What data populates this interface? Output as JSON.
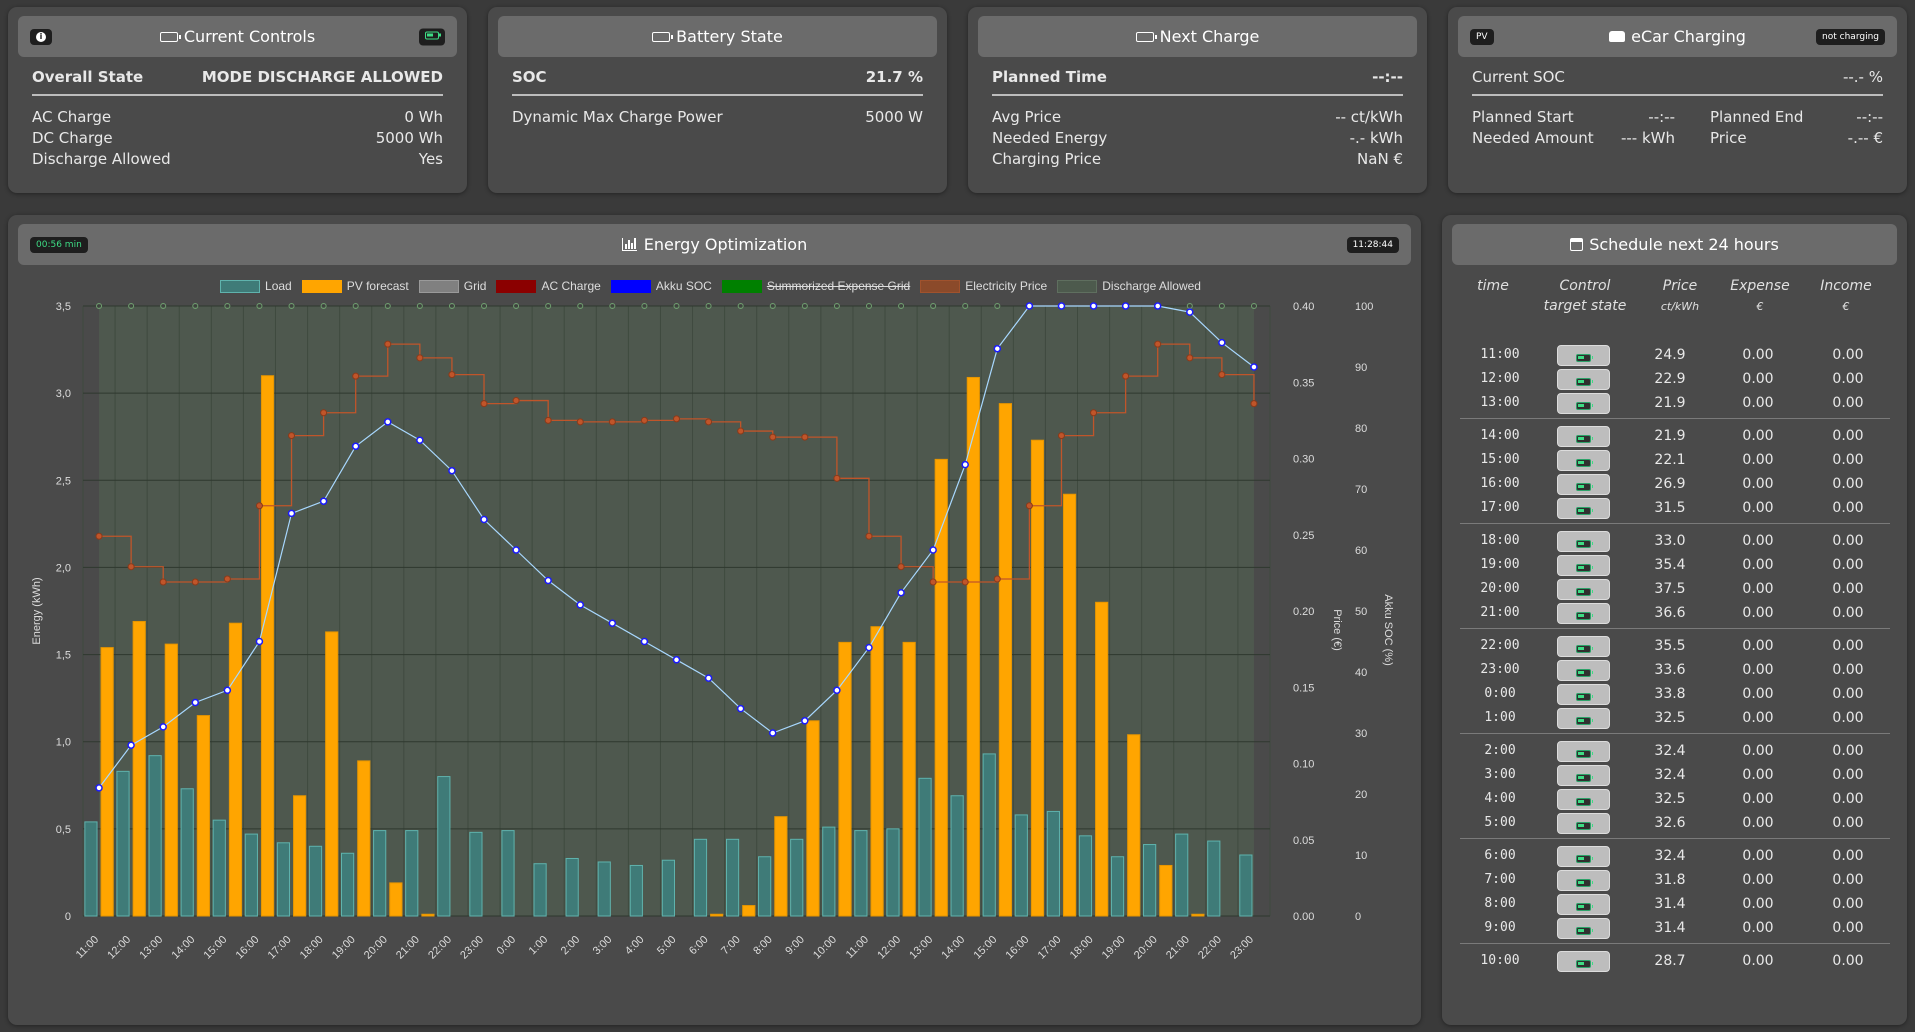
{
  "controls": {
    "title": "Current Controls",
    "overall_label": "Overall State",
    "overall_value": "MODE DISCHARGE ALLOWED",
    "rows": [
      {
        "label": "AC Charge",
        "value": "0 Wh"
      },
      {
        "label": "DC Charge",
        "value": "5000 Wh"
      },
      {
        "label": "Discharge Allowed",
        "value": "Yes"
      }
    ]
  },
  "battery": {
    "title": "Battery State",
    "soc_label": "SOC",
    "soc_value": "21.7 %",
    "rows": [
      {
        "label": "Dynamic Max Charge Power",
        "value": "5000 W"
      }
    ]
  },
  "next_charge": {
    "title": "Next Charge",
    "planned_label": "Planned Time",
    "planned_value": "--:--",
    "rows": [
      {
        "label": "Avg Price",
        "value": "-- ct/kWh"
      },
      {
        "label": "Needed Energy",
        "value": "-.- kWh"
      },
      {
        "label": "Charging Price",
        "value": "NaN €"
      }
    ]
  },
  "ecar": {
    "title": "eCar Charging",
    "badge_left": "PV",
    "badge_right": "not charging",
    "soc_label": "Current SOC",
    "soc_value": "--.- %",
    "left_rows": [
      {
        "label": "Planned Start",
        "value": "--:--"
      },
      {
        "label": "Needed Amount",
        "value": "--- kWh"
      }
    ],
    "right_rows": [
      {
        "label": "Planned End",
        "value": "--:--"
      },
      {
        "label": "Price",
        "value": "-.-- €"
      }
    ]
  },
  "optimization": {
    "title": "Energy Optimization",
    "badge_left": "00:56 min",
    "badge_right": "11:28:44",
    "legend": [
      {
        "label": "Load",
        "fill": "#3f7b78",
        "border": "#5fb3ad"
      },
      {
        "label": "PV forecast",
        "fill": "#ffa500",
        "border": "#ffa500"
      },
      {
        "label": "Grid",
        "fill": "#808080",
        "border": "#9a9a9a"
      },
      {
        "label": "AC Charge",
        "fill": "#8b0000",
        "border": "#8b0000"
      },
      {
        "label": "Akku SOC",
        "fill": "#0000ff",
        "border": "#0000ff"
      },
      {
        "label": "Summorized Expense Grid",
        "fill": "#008000",
        "border": "#008000",
        "strike": true
      },
      {
        "label": "Electricity Price",
        "fill": "#8b4a2a",
        "border": "#a0522d"
      },
      {
        "label": "Discharge Allowed",
        "fill": "#4d5a4d",
        "border": "#5f6f5f"
      }
    ]
  },
  "chart_data": {
    "type": "bar",
    "title": "",
    "categories": [
      "11:00",
      "12:00",
      "13:00",
      "14:00",
      "15:00",
      "16:00",
      "17:00",
      "18:00",
      "19:00",
      "20:00",
      "21:00",
      "22:00",
      "23:00",
      "0:00",
      "1:00",
      "2:00",
      "3:00",
      "4:00",
      "5:00",
      "6:00",
      "7:00",
      "8:00",
      "9:00",
      "10:00",
      "11:00",
      "12:00",
      "13:00",
      "14:00",
      "15:00",
      "16:00",
      "17:00",
      "18:00",
      "19:00",
      "20:00",
      "21:00",
      "22:00",
      "23:00"
    ],
    "y_left": {
      "label": "Energy (kWh)",
      "ticks": [
        "0",
        "0,5",
        "1,0",
        "1,5",
        "2,0",
        "2,5",
        "3,0",
        "3,5"
      ],
      "range": [
        0,
        3.5
      ]
    },
    "y_price": {
      "label": "Price (€)",
      "ticks": [
        "0.00",
        "0.05",
        "0.10",
        "0.15",
        "0.20",
        "0.25",
        "0.30",
        "0.35",
        "0.40"
      ],
      "range": [
        0,
        0.4
      ]
    },
    "y_soc": {
      "label": "Akku SOC (%)",
      "ticks": [
        "0",
        "10",
        "20",
        "30",
        "40",
        "50",
        "60",
        "70",
        "80",
        "90",
        "100"
      ],
      "range": [
        0,
        100
      ]
    },
    "series": [
      {
        "name": "Load",
        "axis": "energy",
        "values": [
          0.54,
          0.83,
          0.92,
          0.73,
          0.55,
          0.47,
          0.42,
          0.4,
          0.36,
          0.49,
          0.49,
          0.8,
          0.48,
          0.49,
          0.3,
          0.33,
          0.31,
          0.29,
          0.32,
          0.44,
          0.44,
          0.34,
          0.44,
          0.51,
          0.49,
          0.5,
          0.79,
          0.69,
          0.93,
          0.58,
          0.6,
          0.46,
          0.34,
          0.41,
          0.47,
          0.43,
          0.35
        ]
      },
      {
        "name": "PV forecast",
        "axis": "energy",
        "values": [
          1.54,
          1.69,
          1.56,
          1.15,
          1.68,
          3.1,
          0.69,
          1.63,
          0.89,
          0.19,
          0.01,
          0,
          0,
          0,
          0,
          0,
          0,
          0,
          0,
          0.01,
          0.06,
          0.57,
          1.12,
          1.57,
          1.66,
          1.57,
          2.62,
          3.09,
          2.94,
          2.73,
          2.42,
          1.8,
          1.04,
          0.29,
          0.01,
          0,
          0
        ]
      },
      {
        "name": "Electricity Price",
        "axis": "price",
        "values": [
          0.249,
          0.229,
          0.219,
          0.219,
          0.221,
          0.269,
          0.315,
          0.33,
          0.354,
          0.375,
          0.366,
          0.355,
          0.336,
          0.338,
          0.325,
          0.324,
          0.324,
          0.325,
          0.326,
          0.324,
          0.318,
          0.314,
          0.314,
          0.287,
          0.249,
          0.229,
          0.219,
          0.219,
          0.221,
          0.269,
          0.315,
          0.33,
          0.354,
          0.375,
          0.366,
          0.355,
          0.336
        ]
      },
      {
        "name": "Akku SOC",
        "axis": "soc",
        "values": [
          21,
          28,
          31,
          35,
          37,
          45,
          66,
          68,
          77,
          81,
          78,
          73,
          65,
          60,
          55,
          51,
          48,
          45,
          42,
          39,
          34,
          30,
          32,
          37,
          44,
          53,
          60,
          74,
          93,
          100,
          100,
          100,
          100,
          100,
          99,
          94,
          90
        ]
      },
      {
        "name": "Discharge Allowed",
        "axis": "soc",
        "values": [
          100,
          100,
          100,
          100,
          100,
          100,
          100,
          100,
          100,
          100,
          100,
          100,
          100,
          100,
          100,
          100,
          100,
          100,
          100,
          100,
          100,
          100,
          100,
          100,
          100,
          100,
          100,
          100,
          100,
          100,
          100,
          100,
          100,
          100,
          100,
          100,
          100
        ]
      }
    ]
  },
  "schedule": {
    "title": "Schedule next 24 hours",
    "headers": {
      "time": "time",
      "control": "Control",
      "control_sub": "target state",
      "price": "Price",
      "price_sub": "ct/kWh",
      "expense": "Expense",
      "expense_sub": "€",
      "income": "Income",
      "income_sub": "€"
    },
    "groups": [
      [
        {
          "time": "11:00",
          "price": "24.9",
          "expense": "0.00",
          "income": "0.00"
        },
        {
          "time": "12:00",
          "price": "22.9",
          "expense": "0.00",
          "income": "0.00"
        },
        {
          "time": "13:00",
          "price": "21.9",
          "expense": "0.00",
          "income": "0.00"
        }
      ],
      [
        {
          "time": "14:00",
          "price": "21.9",
          "expense": "0.00",
          "income": "0.00"
        },
        {
          "time": "15:00",
          "price": "22.1",
          "expense": "0.00",
          "income": "0.00"
        },
        {
          "time": "16:00",
          "price": "26.9",
          "expense": "0.00",
          "income": "0.00"
        },
        {
          "time": "17:00",
          "price": "31.5",
          "expense": "0.00",
          "income": "0.00"
        }
      ],
      [
        {
          "time": "18:00",
          "price": "33.0",
          "expense": "0.00",
          "income": "0.00"
        },
        {
          "time": "19:00",
          "price": "35.4",
          "expense": "0.00",
          "income": "0.00"
        },
        {
          "time": "20:00",
          "price": "37.5",
          "expense": "0.00",
          "income": "0.00"
        },
        {
          "time": "21:00",
          "price": "36.6",
          "expense": "0.00",
          "income": "0.00"
        }
      ],
      [
        {
          "time": "22:00",
          "price": "35.5",
          "expense": "0.00",
          "income": "0.00"
        },
        {
          "time": "23:00",
          "price": "33.6",
          "expense": "0.00",
          "income": "0.00"
        },
        {
          "time": "0:00",
          "price": "33.8",
          "expense": "0.00",
          "income": "0.00"
        },
        {
          "time": "1:00",
          "price": "32.5",
          "expense": "0.00",
          "income": "0.00"
        }
      ],
      [
        {
          "time": "2:00",
          "price": "32.4",
          "expense": "0.00",
          "income": "0.00"
        },
        {
          "time": "3:00",
          "price": "32.4",
          "expense": "0.00",
          "income": "0.00"
        },
        {
          "time": "4:00",
          "price": "32.5",
          "expense": "0.00",
          "income": "0.00"
        },
        {
          "time": "5:00",
          "price": "32.6",
          "expense": "0.00",
          "income": "0.00"
        }
      ],
      [
        {
          "time": "6:00",
          "price": "32.4",
          "expense": "0.00",
          "income": "0.00"
        },
        {
          "time": "7:00",
          "price": "31.8",
          "expense": "0.00",
          "income": "0.00"
        },
        {
          "time": "8:00",
          "price": "31.4",
          "expense": "0.00",
          "income": "0.00"
        },
        {
          "time": "9:00",
          "price": "31.4",
          "expense": "0.00",
          "income": "0.00"
        }
      ],
      [
        {
          "time": "10:00",
          "price": "28.7",
          "expense": "0.00",
          "income": "0.00"
        }
      ]
    ]
  }
}
